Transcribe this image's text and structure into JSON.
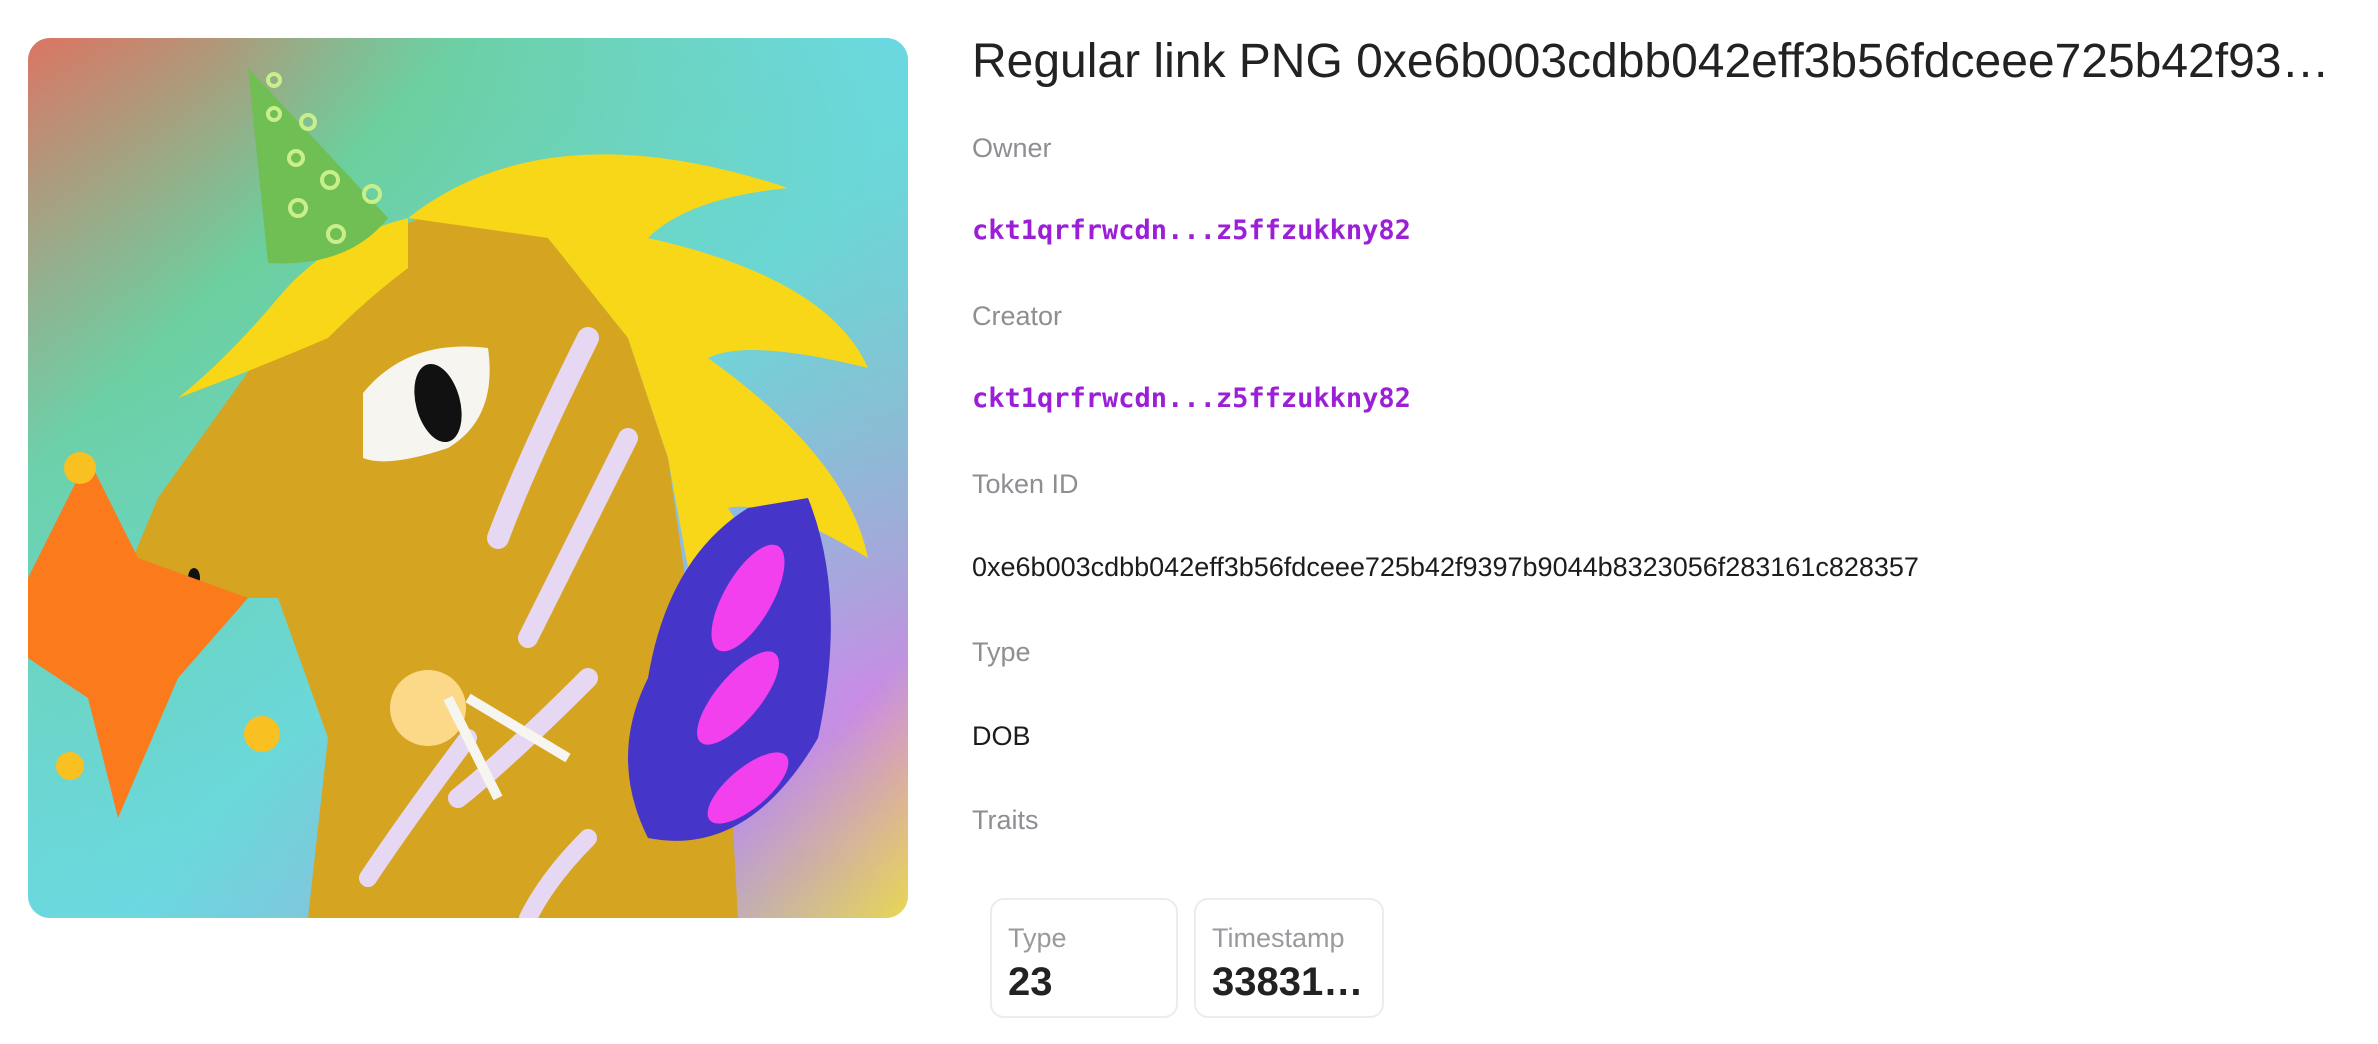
{
  "nft": {
    "title": "Regular link PNG 0xe6b003cdbb042eff3b56fdceee725b42f9397b9044b8323056f283161c828357",
    "owner_label": "Owner",
    "owner_value": "ckt1qrfrwcdn...z5ffzukkny82",
    "creator_label": "Creator",
    "creator_value": "ckt1qrfrwcdn...z5ffzukkny82",
    "token_id_label": "Token ID",
    "token_id_value": "0xe6b003cdbb042eff3b56fdceee725b42f9397b9044b8323056f283161c828357",
    "type_label": "Type",
    "type_value": "DOB",
    "traits_label": "Traits",
    "traits": [
      {
        "name": "Type",
        "value": "23"
      },
      {
        "name": "Timestamp",
        "value": "33831…"
      }
    ]
  },
  "image": {
    "icon": "nft-artwork-image",
    "colors": {
      "corner_top_left": "#e86b5c",
      "gradient_green": "#6ccf9d",
      "gradient_cyan": "#6bd9e4",
      "gradient_purple": "#c98be6",
      "horse": "#d5a420",
      "mane": "#f7d718",
      "hat": "#6fbf54",
      "star": "#fa7a1c",
      "wing": "#4535c8",
      "wing_accent": "#f240ee"
    }
  },
  "colors": {
    "address": "#9b1fd6",
    "label": "#8e8e93",
    "text": "#1c1c1e"
  }
}
